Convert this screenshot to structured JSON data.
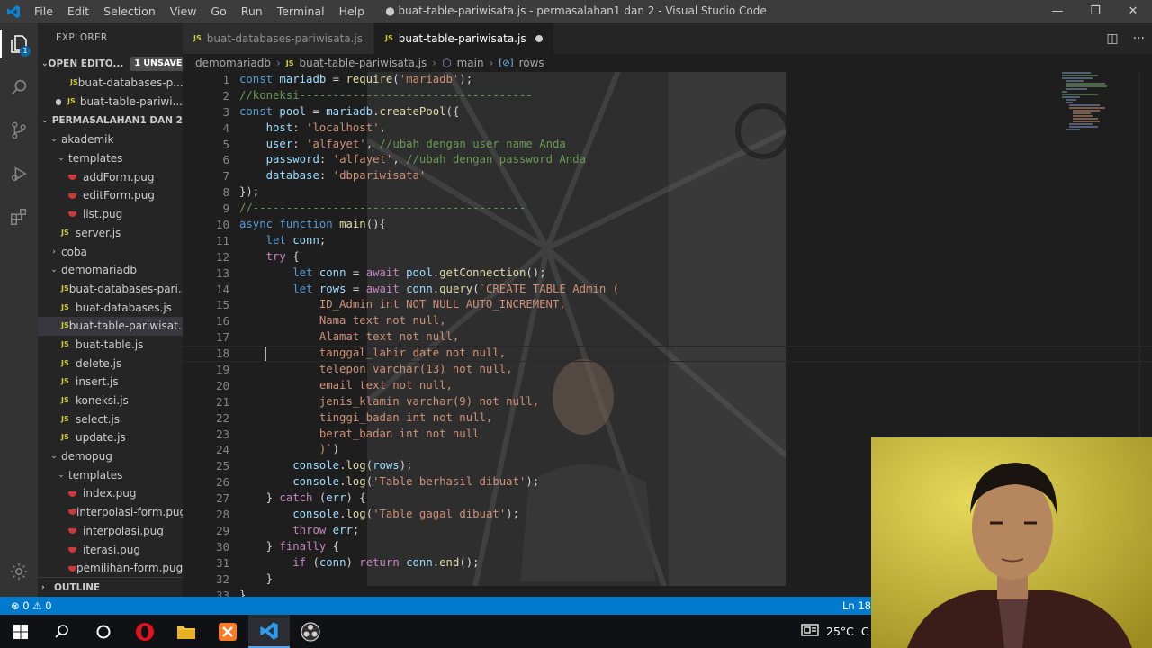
{
  "titlebar": {
    "menu": [
      "File",
      "Edit",
      "Selection",
      "View",
      "Go",
      "Run",
      "Terminal",
      "Help"
    ],
    "title": "● buat-table-pariwisata.js - permasalahan1 dan 2 - Visual Studio Code",
    "minimize": "—",
    "maximize": "❐",
    "close": "✕"
  },
  "activity": {
    "badge": "1"
  },
  "sidebar": {
    "title": "EXPLORER",
    "open_editors": {
      "label": "OPEN EDITO...",
      "unsaved": "1 UNSAVED",
      "items": [
        "buat-databases-p...",
        "buat-table-pariwi..."
      ]
    },
    "workspace": {
      "label": "PERMASALAHAN1 DAN 2",
      "items": [
        {
          "label": "akademik",
          "type": "folder-open",
          "depth": 1
        },
        {
          "label": "templates",
          "type": "folder-open",
          "depth": 2
        },
        {
          "label": "addForm.pug",
          "type": "pug",
          "depth": 3
        },
        {
          "label": "editForm.pug",
          "type": "pug",
          "depth": 3
        },
        {
          "label": "list.pug",
          "type": "pug",
          "depth": 3
        },
        {
          "label": "server.js",
          "type": "js",
          "depth": 2
        },
        {
          "label": "coba",
          "type": "folder",
          "depth": 1
        },
        {
          "label": "demomariadb",
          "type": "folder-open",
          "depth": 1
        },
        {
          "label": "buat-databases-pari...",
          "type": "js",
          "depth": 2
        },
        {
          "label": "buat-databases.js",
          "type": "js",
          "depth": 2
        },
        {
          "label": "buat-table-pariwisat...",
          "type": "js",
          "depth": 2,
          "selected": true
        },
        {
          "label": "buat-table.js",
          "type": "js",
          "depth": 2
        },
        {
          "label": "delete.js",
          "type": "js",
          "depth": 2
        },
        {
          "label": "insert.js",
          "type": "js",
          "depth": 2
        },
        {
          "label": "koneksi.js",
          "type": "js",
          "depth": 2
        },
        {
          "label": "select.js",
          "type": "js",
          "depth": 2
        },
        {
          "label": "update.js",
          "type": "js",
          "depth": 2
        },
        {
          "label": "demopug",
          "type": "folder-open",
          "depth": 1
        },
        {
          "label": "templates",
          "type": "folder-open",
          "depth": 2
        },
        {
          "label": "index.pug",
          "type": "pug",
          "depth": 3
        },
        {
          "label": "interpolasi-form.pug",
          "type": "pug",
          "depth": 3
        },
        {
          "label": "interpolasi.pug",
          "type": "pug",
          "depth": 3
        },
        {
          "label": "iterasi.pug",
          "type": "pug",
          "depth": 3
        },
        {
          "label": "pemilihan-form.pug",
          "type": "pug",
          "depth": 3
        }
      ]
    },
    "outline": "OUTLINE"
  },
  "tabs": [
    {
      "label": "buat-databases-pariwisata.js",
      "active": false
    },
    {
      "label": "buat-table-pariwisata.js",
      "active": true,
      "modified": true
    }
  ],
  "breadcrumb": [
    "demomariadb",
    "buat-table-pariwisata.js",
    "main",
    "rows"
  ],
  "editor": {
    "line_numbers": [
      "1",
      "2",
      "3",
      "4",
      "5",
      "6",
      "7",
      "8",
      "9",
      "10",
      "11",
      "12",
      "13",
      "14",
      "15",
      "16",
      "17",
      "18",
      "19",
      "20",
      "21",
      "22",
      "23",
      "24",
      "25",
      "26",
      "27",
      "28",
      "29",
      "30",
      "31",
      "32",
      "33"
    ],
    "lines": [
      [
        [
          "kw",
          "const "
        ],
        [
          "var",
          "mariadb"
        ],
        [
          "pn",
          " = "
        ],
        [
          "fn",
          "require"
        ],
        [
          "pn",
          "("
        ],
        [
          "str",
          "'mariadb'"
        ],
        [
          "pn",
          ");"
        ]
      ],
      [
        [
          "cm",
          "//koneksi-----------------------------------"
        ]
      ],
      [
        [
          "kw",
          "const "
        ],
        [
          "var",
          "pool"
        ],
        [
          "pn",
          " = "
        ],
        [
          "var",
          "mariadb"
        ],
        [
          "pn",
          "."
        ],
        [
          "fn",
          "createPool"
        ],
        [
          "pn",
          "({"
        ]
      ],
      [
        [
          "pn",
          "    "
        ],
        [
          "var",
          "host"
        ],
        [
          "pn",
          ": "
        ],
        [
          "str",
          "'localhost'"
        ],
        [
          "pn",
          ","
        ]
      ],
      [
        [
          "pn",
          "    "
        ],
        [
          "var",
          "user"
        ],
        [
          "pn",
          ": "
        ],
        [
          "str",
          "'alfayet'"
        ],
        [
          "pn",
          ", "
        ],
        [
          "cm",
          "//ubah dengan user name Anda"
        ]
      ],
      [
        [
          "pn",
          "    "
        ],
        [
          "var",
          "password"
        ],
        [
          "pn",
          ": "
        ],
        [
          "str",
          "'alfayet'"
        ],
        [
          "pn",
          ", "
        ],
        [
          "cm",
          "//ubah dengan password Anda"
        ]
      ],
      [
        [
          "pn",
          "    "
        ],
        [
          "var",
          "database"
        ],
        [
          "pn",
          ": "
        ],
        [
          "str",
          "'dbpariwisata'"
        ]
      ],
      [
        [
          "pn",
          "});"
        ]
      ],
      [
        [
          "cm",
          "//-----------------------------------------"
        ]
      ],
      [
        [
          "kw",
          "async "
        ],
        [
          "kw",
          "function "
        ],
        [
          "fn",
          "main"
        ],
        [
          "pn",
          "(){"
        ]
      ],
      [
        [
          "pn",
          "    "
        ],
        [
          "kw",
          "let "
        ],
        [
          "var",
          "conn"
        ],
        [
          "pn",
          ";"
        ]
      ],
      [
        [
          "pn",
          "    "
        ],
        [
          "ctl",
          "try"
        ],
        [
          "pn",
          " {"
        ]
      ],
      [
        [
          "pn",
          "        "
        ],
        [
          "kw",
          "let "
        ],
        [
          "var",
          "conn"
        ],
        [
          "pn",
          " = "
        ],
        [
          "ctl",
          "await "
        ],
        [
          "var",
          "pool"
        ],
        [
          "pn",
          "."
        ],
        [
          "fn",
          "getConnection"
        ],
        [
          "pn",
          "();"
        ]
      ],
      [
        [
          "pn",
          "        "
        ],
        [
          "kw",
          "let "
        ],
        [
          "var",
          "rows"
        ],
        [
          "pn",
          " = "
        ],
        [
          "ctl",
          "await "
        ],
        [
          "var",
          "conn"
        ],
        [
          "pn",
          "."
        ],
        [
          "fn",
          "query"
        ],
        [
          "pn",
          "("
        ],
        [
          "str",
          "`CREATE TABLE Admin ("
        ]
      ],
      [
        [
          "str",
          "            ID_Admin int NOT NULL AUTO_INCREMENT,"
        ]
      ],
      [
        [
          "str",
          "            Nama text not null,"
        ]
      ],
      [
        [
          "str",
          "            Alamat text not null,"
        ]
      ],
      [
        [
          "str",
          "            tanggal_lahir date not null,"
        ]
      ],
      [
        [
          "str",
          "            telepon varchar(13) not null,"
        ]
      ],
      [
        [
          "str",
          "            email text not null,"
        ]
      ],
      [
        [
          "str",
          "            jenis_klamin varchar(9) not null,"
        ]
      ],
      [
        [
          "str",
          "            tinggi_badan int not null,"
        ]
      ],
      [
        [
          "str",
          "            berat_badan int not null"
        ]
      ],
      [
        [
          "str",
          "            )`"
        ],
        [
          "pn",
          ")"
        ]
      ],
      [
        [
          "pn",
          "        "
        ],
        [
          "var",
          "console"
        ],
        [
          "pn",
          "."
        ],
        [
          "fn",
          "log"
        ],
        [
          "pn",
          "("
        ],
        [
          "var",
          "rows"
        ],
        [
          "pn",
          ");"
        ]
      ],
      [
        [
          "pn",
          "        "
        ],
        [
          "var",
          "console"
        ],
        [
          "pn",
          "."
        ],
        [
          "fn",
          "log"
        ],
        [
          "pn",
          "("
        ],
        [
          "str",
          "'Table berhasil dibuat'"
        ],
        [
          "pn",
          ");"
        ]
      ],
      [
        [
          "pn",
          "    } "
        ],
        [
          "ctl",
          "catch"
        ],
        [
          "pn",
          " ("
        ],
        [
          "var",
          "err"
        ],
        [
          "pn",
          ") {"
        ]
      ],
      [
        [
          "pn",
          "        "
        ],
        [
          "var",
          "console"
        ],
        [
          "pn",
          "."
        ],
        [
          "fn",
          "log"
        ],
        [
          "pn",
          "("
        ],
        [
          "str",
          "'Table gagal dibuat'"
        ],
        [
          "pn",
          ");"
        ]
      ],
      [
        [
          "pn",
          "        "
        ],
        [
          "ctl",
          "throw "
        ],
        [
          "var",
          "err"
        ],
        [
          "pn",
          ";"
        ]
      ],
      [
        [
          "pn",
          "    } "
        ],
        [
          "ctl",
          "finally"
        ],
        [
          "pn",
          " {"
        ]
      ],
      [
        [
          "pn",
          "        "
        ],
        [
          "ctl",
          "if"
        ],
        [
          "pn",
          " ("
        ],
        [
          "var",
          "conn"
        ],
        [
          "pn",
          ") "
        ],
        [
          "ctl",
          "return "
        ],
        [
          "var",
          "conn"
        ],
        [
          "pn",
          "."
        ],
        [
          "fn",
          "end"
        ],
        [
          "pn",
          "();"
        ]
      ],
      [
        [
          "pn",
          "    }"
        ]
      ],
      [
        [
          "pn",
          "}"
        ]
      ]
    ]
  },
  "statusbar": {
    "problems": "⊗ 0 ⚠ 0",
    "position": "Ln 18"
  },
  "taskbar": {
    "temperature": "25°C",
    "tray_text": "C"
  },
  "colors": {
    "accent": "#007acc",
    "titlebar": "#3c3c3c",
    "sidebar": "#252526",
    "editor": "#1e1e1e"
  }
}
